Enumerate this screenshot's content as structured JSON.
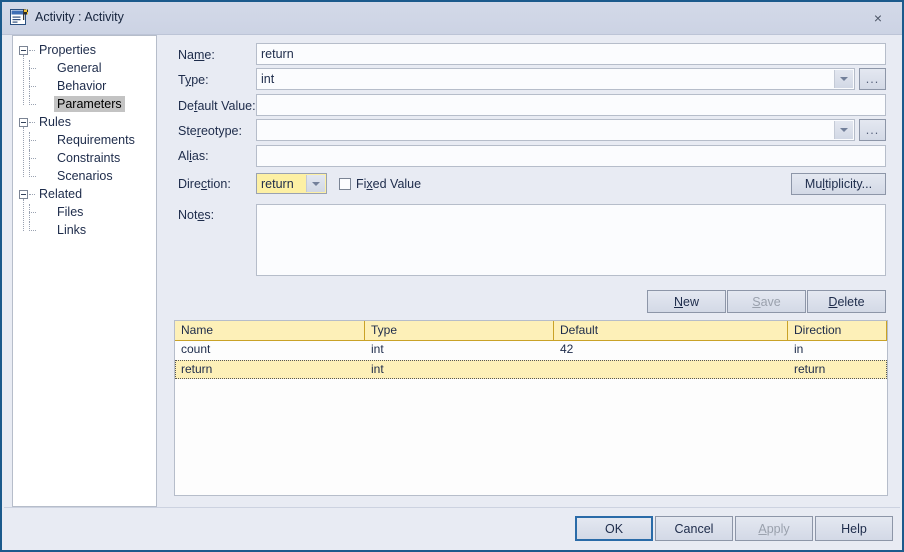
{
  "window": {
    "title": "Activity : Activity",
    "icon": "activity-dialog-icon",
    "close_label": "×"
  },
  "tree": {
    "nodes": [
      {
        "label": "Properties",
        "level": 0,
        "expander": true,
        "selected": false
      },
      {
        "label": "General",
        "level": 1,
        "expander": false,
        "selected": false
      },
      {
        "label": "Behavior",
        "level": 1,
        "expander": false,
        "selected": false
      },
      {
        "label": "Parameters",
        "level": 1,
        "expander": false,
        "selected": true
      },
      {
        "label": "Rules",
        "level": 0,
        "expander": true,
        "selected": false
      },
      {
        "label": "Requirements",
        "level": 1,
        "expander": false,
        "selected": false
      },
      {
        "label": "Constraints",
        "level": 1,
        "expander": false,
        "selected": false
      },
      {
        "label": "Scenarios",
        "level": 1,
        "expander": false,
        "selected": false
      },
      {
        "label": "Related",
        "level": 0,
        "expander": true,
        "selected": false
      },
      {
        "label": "Files",
        "level": 1,
        "expander": false,
        "selected": false
      },
      {
        "label": "Links",
        "level": 1,
        "expander": false,
        "selected": false
      }
    ]
  },
  "form": {
    "name": {
      "label_pre": "Na",
      "label_accel": "m",
      "label_post": "e:",
      "value": "return"
    },
    "type": {
      "label_pre": "T",
      "label_accel": "y",
      "label_post": "pe:",
      "value": "int"
    },
    "default_value": {
      "label_pre": "De",
      "label_accel": "f",
      "label_post": "ault Value:",
      "value": ""
    },
    "stereotype": {
      "label_pre": "Ste",
      "label_accel": "r",
      "label_post": "eotype:",
      "value": ""
    },
    "alias": {
      "label_pre": "Al",
      "label_accel": "i",
      "label_post": "as:",
      "value": ""
    },
    "direction": {
      "label_pre": "Dire",
      "label_accel": "c",
      "label_post": "tion:",
      "value": "return"
    },
    "notes": {
      "label_pre": "Not",
      "label_accel": "e",
      "label_post": "s:",
      "value": ""
    },
    "fixed_value": {
      "label_pre": "Fi",
      "label_accel": "x",
      "label_post": "ed Value",
      "checked": false
    },
    "browse_type_label": "...",
    "browse_stereotype_label": "...",
    "multiplicity": {
      "label_pre": "Mu",
      "label_accel": "l",
      "label_post": "tiplicity..."
    }
  },
  "record_buttons": [
    {
      "label_pre": "",
      "label_accel": "N",
      "label_post": "ew",
      "name": "new-button",
      "disabled": false
    },
    {
      "label_pre": "",
      "label_accel": "S",
      "label_post": "ave",
      "name": "save-button",
      "disabled": true
    },
    {
      "label_pre": "",
      "label_accel": "D",
      "label_post": "elete",
      "name": "delete-button",
      "disabled": false
    }
  ],
  "grid": {
    "columns": [
      "Name",
      "Type",
      "Default",
      "Direction"
    ],
    "rows": [
      {
        "cells": [
          "count",
          "int",
          "42",
          "in"
        ],
        "selected": false
      },
      {
        "cells": [
          "return",
          "int",
          "",
          "return"
        ],
        "selected": true
      }
    ]
  },
  "dialog_buttons": [
    {
      "label_pre": "OK",
      "label_accel": "",
      "label_post": "",
      "name": "ok-button",
      "disabled": false,
      "default": true
    },
    {
      "label_pre": "Cancel",
      "label_accel": "",
      "label_post": "",
      "name": "cancel-button",
      "disabled": false,
      "default": false
    },
    {
      "label_pre": "",
      "label_accel": "A",
      "label_post": "pply",
      "name": "apply-button",
      "disabled": true,
      "default": false
    },
    {
      "label_pre": "Help",
      "label_accel": "",
      "label_post": "",
      "name": "help-button",
      "disabled": false,
      "default": false
    }
  ],
  "colors": {
    "window_border": "#1b5a8c",
    "dialog_bg": "#e8ebf3",
    "titlebar_bg": "#d3d9e8",
    "grid_header_bg": "#fdf0b8",
    "selected_row_bg": "#fdf0b8",
    "combo_highlight_bg": "#fdf0a4",
    "tree_selection_bg": "#c3c3c3",
    "default_button_border": "#2a6ba8"
  }
}
